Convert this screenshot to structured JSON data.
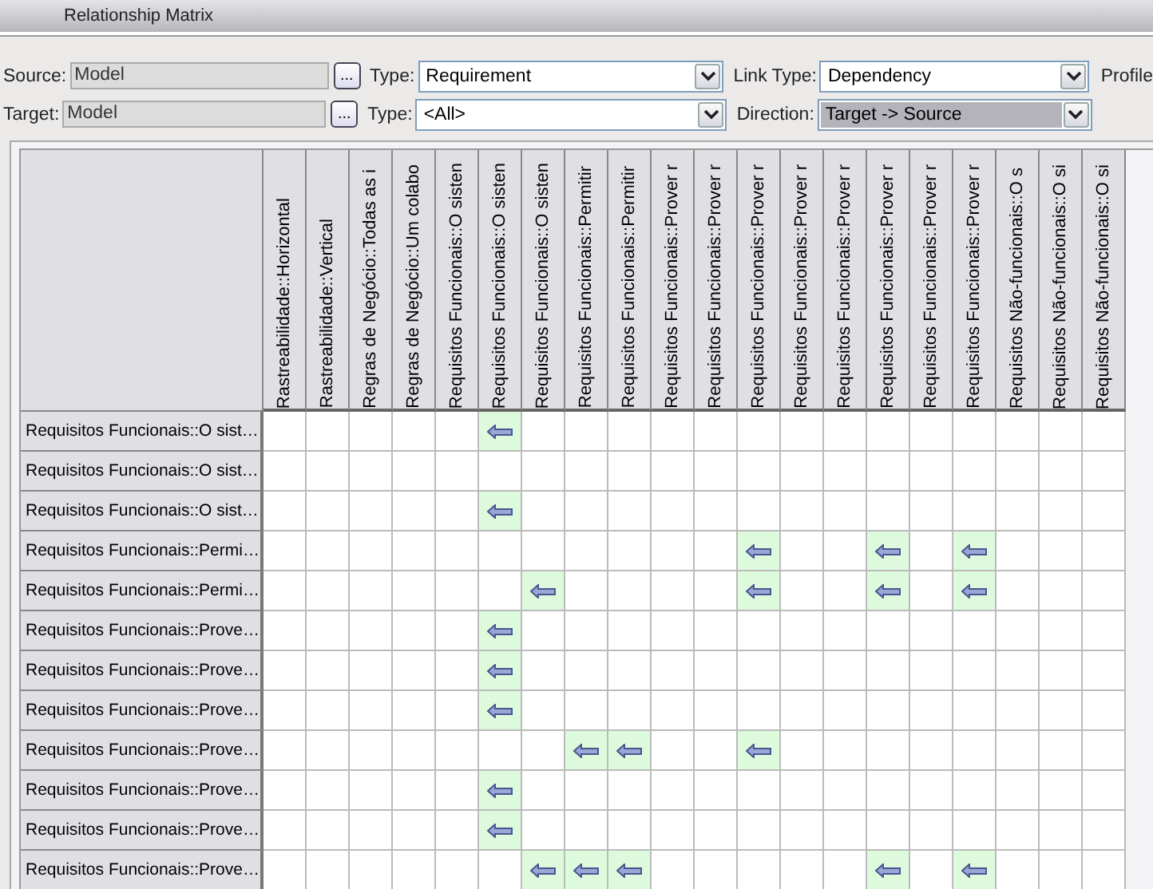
{
  "window": {
    "title": "Relationship Matrix"
  },
  "source": {
    "label": "Source:",
    "value": "Model",
    "browse": "...",
    "type_label": "Type:",
    "type": "Requirement",
    "link_type_label": "Link Type:",
    "link_type": "Dependency",
    "profile_label": "Profile"
  },
  "target": {
    "label": "Target:",
    "value": "Model",
    "browse": "...",
    "type_label": "Type:",
    "type": "<All>",
    "direction_label": "Direction:",
    "direction": "Target -> Source",
    "direction_highlighted": true
  },
  "columns": [
    "Rastreabilidade::Horizontal",
    "Rastreabilidade::Vertical",
    "Regras de Negócio::Todas as i",
    "Regras de Negócio::Um colabo",
    "Requisitos Funcionais::O sisten",
    "Requisitos Funcionais::O sisten",
    "Requisitos Funcionais::O sisten",
    "Requisitos Funcionais::Permitir",
    "Requisitos Funcionais::Permitir",
    "Requisitos Funcionais::Prover r",
    "Requisitos Funcionais::Prover r",
    "Requisitos Funcionais::Prover r",
    "Requisitos Funcionais::Prover r",
    "Requisitos Funcionais::Prover r",
    "Requisitos Funcionais::Prover r",
    "Requisitos Funcionais::Prover r",
    "Requisitos Funcionais::Prover r",
    "Requisitos Não-funcionais::O s",
    "Requisitos Não-funcionais::O si",
    "Requisitos Não-funcionais::O si"
  ],
  "rows": [
    {
      "label": "Requisitos Funcionais::O sist…",
      "cells": [
        false,
        false,
        false,
        false,
        false,
        true,
        false,
        false,
        false,
        false,
        false,
        false,
        false,
        false,
        false,
        false,
        false,
        false,
        false,
        false
      ]
    },
    {
      "label": "Requisitos Funcionais::O sist…",
      "cells": [
        false,
        false,
        false,
        false,
        false,
        false,
        false,
        false,
        false,
        false,
        false,
        false,
        false,
        false,
        false,
        false,
        false,
        false,
        false,
        false
      ]
    },
    {
      "label": "Requisitos Funcionais::O sist…",
      "cells": [
        false,
        false,
        false,
        false,
        false,
        true,
        false,
        false,
        false,
        false,
        false,
        false,
        false,
        false,
        false,
        false,
        false,
        false,
        false,
        false
      ]
    },
    {
      "label": "Requisitos Funcionais::Permi…",
      "cells": [
        false,
        false,
        false,
        false,
        false,
        false,
        false,
        false,
        false,
        false,
        false,
        true,
        false,
        false,
        true,
        false,
        true,
        false,
        false,
        false
      ]
    },
    {
      "label": "Requisitos Funcionais::Permi…",
      "cells": [
        false,
        false,
        false,
        false,
        false,
        false,
        true,
        false,
        false,
        false,
        false,
        true,
        false,
        false,
        true,
        false,
        true,
        false,
        false,
        false
      ]
    },
    {
      "label": "Requisitos Funcionais::Prove…",
      "cells": [
        false,
        false,
        false,
        false,
        false,
        true,
        false,
        false,
        false,
        false,
        false,
        false,
        false,
        false,
        false,
        false,
        false,
        false,
        false,
        false
      ]
    },
    {
      "label": "Requisitos Funcionais::Prove…",
      "cells": [
        false,
        false,
        false,
        false,
        false,
        true,
        false,
        false,
        false,
        false,
        false,
        false,
        false,
        false,
        false,
        false,
        false,
        false,
        false,
        false
      ]
    },
    {
      "label": "Requisitos Funcionais::Prove…",
      "cells": [
        false,
        false,
        false,
        false,
        false,
        true,
        false,
        false,
        false,
        false,
        false,
        false,
        false,
        false,
        false,
        false,
        false,
        false,
        false,
        false
      ]
    },
    {
      "label": "Requisitos Funcionais::Prove…",
      "cells": [
        false,
        false,
        false,
        false,
        false,
        false,
        false,
        true,
        true,
        false,
        false,
        true,
        false,
        false,
        false,
        false,
        false,
        false,
        false,
        false
      ]
    },
    {
      "label": "Requisitos Funcionais::Prove…",
      "cells": [
        false,
        false,
        false,
        false,
        false,
        true,
        false,
        false,
        false,
        false,
        false,
        false,
        false,
        false,
        false,
        false,
        false,
        false,
        false,
        false
      ]
    },
    {
      "label": "Requisitos Funcionais::Prove…",
      "cells": [
        false,
        false,
        false,
        false,
        false,
        true,
        false,
        false,
        false,
        false,
        false,
        false,
        false,
        false,
        false,
        false,
        false,
        false,
        false,
        false
      ]
    },
    {
      "label": "Requisitos Funcionais::Prove…",
      "cells": [
        false,
        false,
        false,
        false,
        false,
        false,
        true,
        true,
        true,
        false,
        false,
        false,
        false,
        false,
        true,
        false,
        true,
        false,
        false,
        false
      ]
    }
  ]
}
